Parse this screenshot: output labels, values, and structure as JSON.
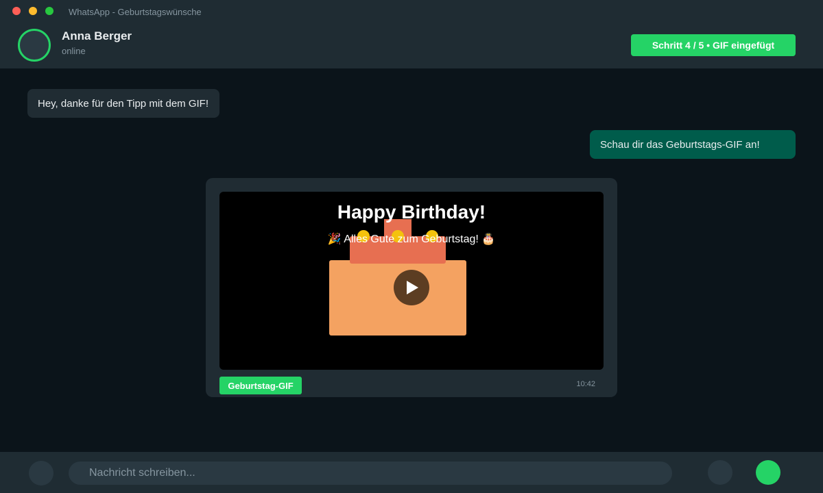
{
  "window": {
    "title": "WhatsApp - Geburtstagswünsche"
  },
  "header": {
    "contact_name": "Anna Berger",
    "contact_status": "online",
    "step_badge": "Schritt 4 / 5 • GIF eingefügt"
  },
  "messages": [
    {
      "direction": "incoming",
      "text": "Hey, danke für den Tipp mit dem GIF!"
    },
    {
      "direction": "outgoing",
      "text": "Schau dir das Geburtstags-GIF an!"
    }
  ],
  "gif_message": {
    "heading": "Happy Birthday!",
    "subtitle": "🎉 Alles Gute zum Geburtstag! 🎂",
    "tag": "Geburtstag-GIF",
    "time": "10:42"
  },
  "composer": {
    "placeholder": "Nachricht schreiben..."
  },
  "icons": {
    "emoji": "emoji-icon",
    "attach": "attach-icon",
    "send": "send-icon",
    "play": "play-icon"
  },
  "colors": {
    "accent": "#25d366",
    "outgoing_bubble": "#005c4b",
    "incoming_bubble": "#202c33",
    "background": "#0b141a"
  }
}
